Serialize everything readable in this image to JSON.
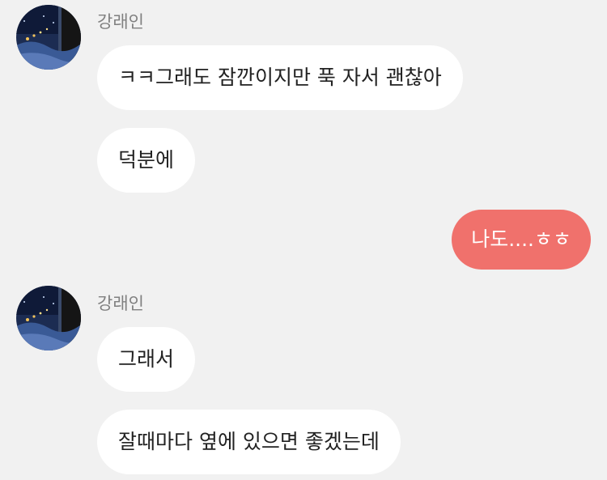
{
  "colors": {
    "background": "#f1f1f1",
    "incoming_bubble": "#ffffff",
    "outgoing_bubble": "#f0716c",
    "sender_name": "#808080",
    "message_text": "#222222"
  },
  "groups": [
    {
      "sender": "강래인",
      "avatar_icon": "night-window-avatar",
      "messages": [
        "ㅋㅋ그래도 잠깐이지만 푹 자서 괜찮아",
        "덕분에"
      ]
    },
    {
      "sender": "me",
      "messages": [
        "나도....ㅎㅎ"
      ]
    },
    {
      "sender": "강래인",
      "avatar_icon": "night-window-avatar",
      "messages": [
        "그래서",
        "잘때마다 옆에 있으면 좋겠는데"
      ]
    }
  ]
}
